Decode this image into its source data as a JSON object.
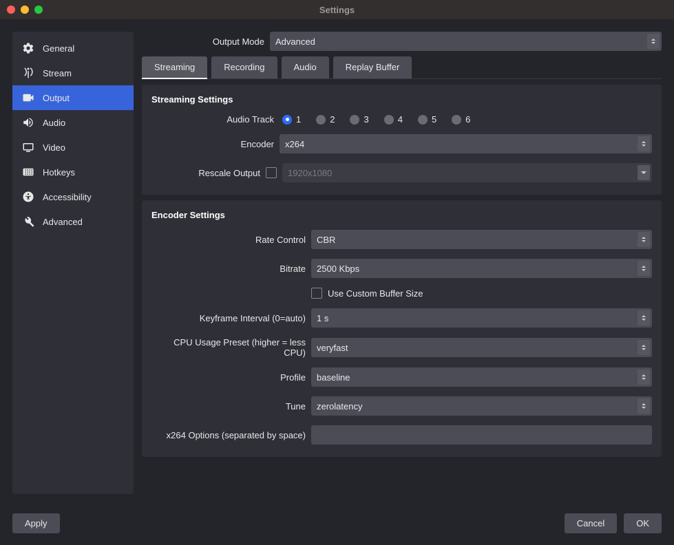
{
  "window": {
    "title": "Settings"
  },
  "sidebar": {
    "items": [
      {
        "key": "general",
        "label": "General",
        "icon": "gear-icon"
      },
      {
        "key": "stream",
        "label": "Stream",
        "icon": "antenna-icon"
      },
      {
        "key": "output",
        "label": "Output",
        "icon": "camera-icon",
        "active": true
      },
      {
        "key": "audio",
        "label": "Audio",
        "icon": "speaker-icon"
      },
      {
        "key": "video",
        "label": "Video",
        "icon": "monitor-icon"
      },
      {
        "key": "hotkeys",
        "label": "Hotkeys",
        "icon": "keyboard-icon"
      },
      {
        "key": "accessibility",
        "label": "Accessibility",
        "icon": "accessibility-icon"
      },
      {
        "key": "advanced",
        "label": "Advanced",
        "icon": "tools-icon"
      }
    ]
  },
  "output_mode": {
    "label": "Output Mode",
    "value": "Advanced"
  },
  "tabs": [
    {
      "key": "streaming",
      "label": "Streaming",
      "active": true
    },
    {
      "key": "recording",
      "label": "Recording"
    },
    {
      "key": "audio",
      "label": "Audio"
    },
    {
      "key": "replay",
      "label": "Replay Buffer"
    }
  ],
  "streaming": {
    "title": "Streaming Settings",
    "audio_track": {
      "label": "Audio Track",
      "options": [
        "1",
        "2",
        "3",
        "4",
        "5",
        "6"
      ],
      "selected": "1"
    },
    "encoder": {
      "label": "Encoder",
      "value": "x264"
    },
    "rescale": {
      "label": "Rescale Output",
      "checked": false,
      "value": "1920x1080",
      "disabled": true
    }
  },
  "encoder": {
    "title": "Encoder Settings",
    "rate_control": {
      "label": "Rate Control",
      "value": "CBR"
    },
    "bitrate": {
      "label": "Bitrate",
      "value": "2500 Kbps"
    },
    "custom_buffer": {
      "label": "Use Custom Buffer Size",
      "checked": false
    },
    "keyframe": {
      "label": "Keyframe Interval (0=auto)",
      "value": "1 s"
    },
    "cpu_preset": {
      "label": "CPU Usage Preset (higher = less CPU)",
      "value": "veryfast"
    },
    "profile": {
      "label": "Profile",
      "value": "baseline"
    },
    "tune": {
      "label": "Tune",
      "value": "zerolatency"
    },
    "x264_options": {
      "label": "x264 Options (separated by space)",
      "value": ""
    }
  },
  "footer": {
    "apply": "Apply",
    "cancel": "Cancel",
    "ok": "OK"
  }
}
